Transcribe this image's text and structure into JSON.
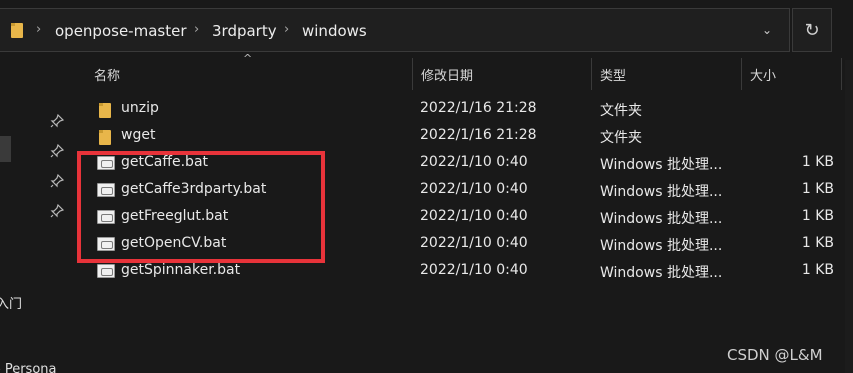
{
  "address": {
    "crumbs": [
      "openpose-master",
      "3rdparty",
      "windows"
    ],
    "separator": "›",
    "dropdown_icon": "chevron-down-icon",
    "refresh_icon": "refresh-icon",
    "refresh_glyph": "↻"
  },
  "columns": {
    "name": "名称",
    "date": "修改日期",
    "type": "类型",
    "size": "大小",
    "sort_indicator": "^"
  },
  "rows": [
    {
      "icon": "folder-icon",
      "name": "unzip",
      "date": "2022/1/16 21:28",
      "type": "文件夹",
      "size": ""
    },
    {
      "icon": "folder-icon",
      "name": "wget",
      "date": "2022/1/16 21:28",
      "type": "文件夹",
      "size": ""
    },
    {
      "icon": "batch-file-icon",
      "name": "getCaffe.bat",
      "date": "2022/1/10 0:40",
      "type": "Windows 批处理...",
      "size": "1 KB"
    },
    {
      "icon": "batch-file-icon",
      "name": "getCaffe3rdparty.bat",
      "date": "2022/1/10 0:40",
      "type": "Windows 批处理...",
      "size": "1 KB"
    },
    {
      "icon": "batch-file-icon",
      "name": "getFreeglut.bat",
      "date": "2022/1/10 0:40",
      "type": "Windows 批处理...",
      "size": "1 KB"
    },
    {
      "icon": "batch-file-icon",
      "name": "getOpenCV.bat",
      "date": "2022/1/10 0:40",
      "type": "Windows 批处理...",
      "size": "1 KB"
    },
    {
      "icon": "batch-file-icon",
      "name": "getSpinnaker.bat",
      "date": "2022/1/10 0:40",
      "type": "Windows 批处理...",
      "size": "1 KB"
    }
  ],
  "left_pane": {
    "partial_text_1": "入门",
    "partial_text_2": "- Persona",
    "pin_icon": "pin-icon"
  },
  "highlight_color": "#e8333a",
  "watermark": "CSDN @L&M"
}
